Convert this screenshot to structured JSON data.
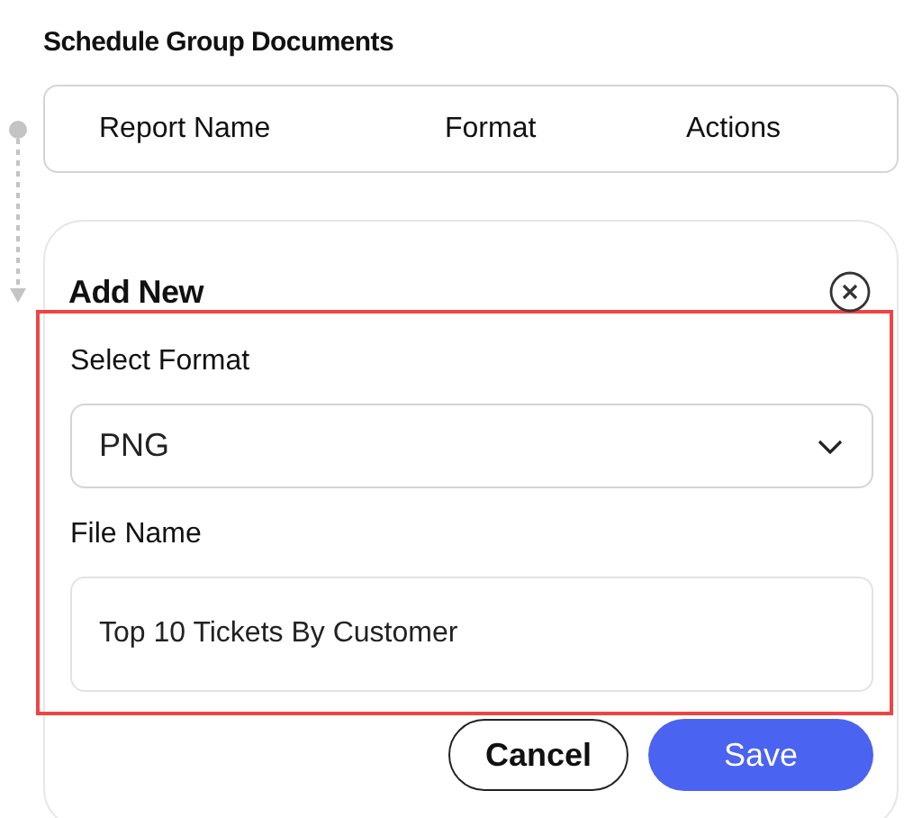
{
  "title": "Schedule Group Documents",
  "table": {
    "columns": [
      "Report Name",
      "Format",
      "Actions"
    ]
  },
  "add_new": {
    "title": "Add New",
    "form": {
      "highlighted": true,
      "format": {
        "label": "Select Format",
        "value": "PNG"
      },
      "file_name": {
        "label": "File Name",
        "value": "Top 10 Tickets By Customer"
      }
    },
    "buttons": [
      {
        "label": "Cancel",
        "kind": "secondary"
      },
      {
        "label": "Save",
        "kind": "primary"
      }
    ]
  }
}
